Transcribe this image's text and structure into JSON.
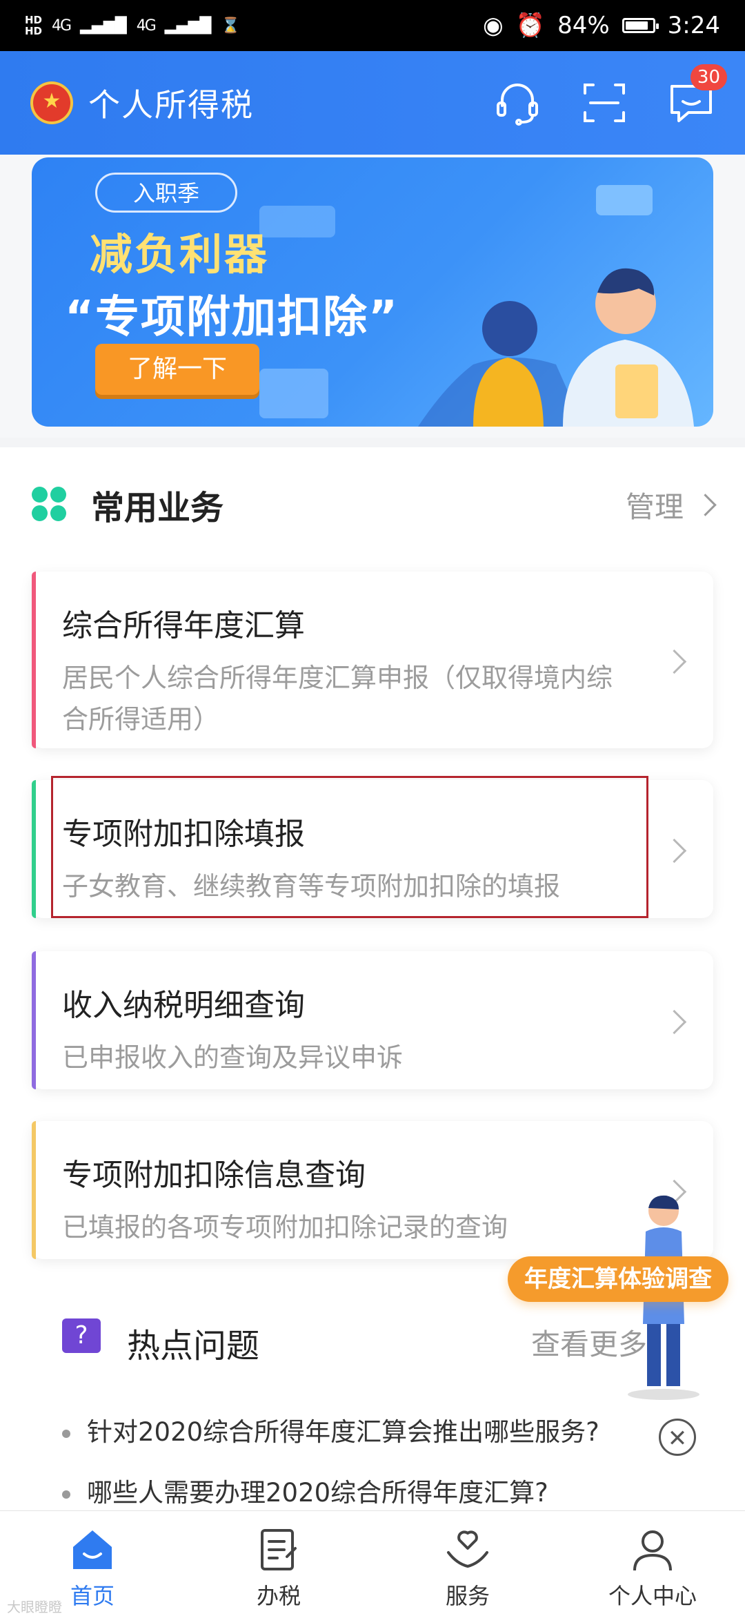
{
  "status_bar": {
    "sim1": "HD",
    "sim2": "HD",
    "network1": "4G",
    "network2": "4G",
    "battery": "84%",
    "battery_fraction": 0.84,
    "time": "3:24"
  },
  "header": {
    "title": "个人所得税",
    "message_badge": "30"
  },
  "banner": {
    "tag": "入职季",
    "title": "减负利器",
    "subtitle": "“专项附加扣除”",
    "button": "了解一下"
  },
  "common": {
    "title": "常用业务",
    "manage": "管理"
  },
  "services": [
    {
      "title": "综合所得年度汇算",
      "desc": "居民个人综合所得年度汇算申报（仅取得境内综合所得适用）",
      "accent": "#f0587c"
    },
    {
      "title": "专项附加扣除填报",
      "desc": "子女教育、继续教育等专项附加扣除的填报",
      "accent": "#31cf8c"
    },
    {
      "title": "收入纳税明细查询",
      "desc": "已申报收入的查询及异议申诉",
      "accent": "#8f6be0"
    },
    {
      "title": "专项附加扣除信息查询",
      "desc": "已填报的各项专项附加扣除记录的查询",
      "accent": "#f4c865"
    }
  ],
  "hot": {
    "title": "热点问题",
    "more": "查看更多",
    "items": [
      "针对2020综合所得年度汇算会推出哪些服务?",
      "哪些人需要办理2020综合所得年度汇算?"
    ]
  },
  "survey": {
    "label": "年度汇算体验调查"
  },
  "tabs": [
    {
      "label": "首页"
    },
    {
      "label": "办税"
    },
    {
      "label": "服务"
    },
    {
      "label": "个人中心"
    }
  ],
  "watermark": "大眼瞪瞪"
}
